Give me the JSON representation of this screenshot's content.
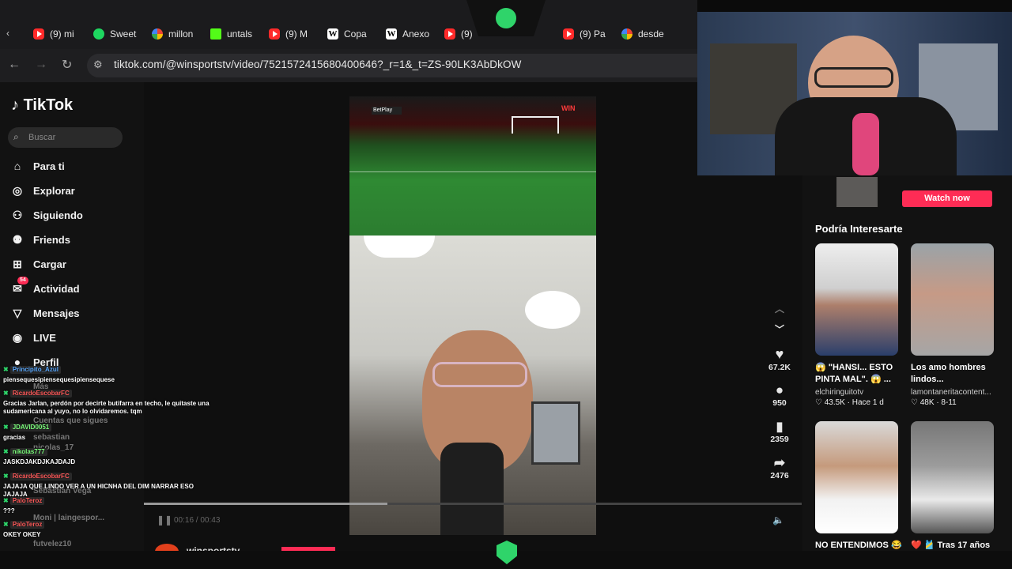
{
  "browser": {
    "tabs": [
      {
        "icon": "youtube-icon",
        "label": "(9) mi"
      },
      {
        "icon": "spotify-icon",
        "label": "Sweet"
      },
      {
        "icon": "google-icon",
        "label": "millon"
      },
      {
        "icon": "kick-icon",
        "label": "untals"
      },
      {
        "icon": "youtube-icon",
        "label": "(9) M"
      },
      {
        "icon": "wikipedia-icon",
        "label": "Copa"
      },
      {
        "icon": "wikipedia-icon",
        "label": "Anexo"
      },
      {
        "icon": "youtube-icon",
        "label": "(9)"
      },
      {
        "icon": "youtube-icon",
        "label": "(9) Pa"
      },
      {
        "icon": "google-icon",
        "label": "desde"
      }
    ],
    "url": "tiktok.com/@winsportstv/video/7521572415680400646?_r=1&_t=ZS-90LK3AbDkOW"
  },
  "tiktok": {
    "logo": "TikTok",
    "search_placeholder": "Buscar",
    "nav": [
      {
        "icon": "home-icon",
        "label": "Para ti"
      },
      {
        "icon": "compass-icon",
        "label": "Explorar"
      },
      {
        "icon": "following-icon",
        "label": "Siguiendo"
      },
      {
        "icon": "friends-icon",
        "label": "Friends"
      },
      {
        "icon": "upload-icon",
        "label": "Cargar"
      },
      {
        "icon": "activity-icon",
        "label": "Actividad",
        "badge": "54"
      },
      {
        "icon": "messages-icon",
        "label": "Mensajes"
      },
      {
        "icon": "live-icon",
        "label": "LIVE"
      },
      {
        "icon": "profile-icon",
        "label": "Perfil"
      }
    ],
    "sidebar_extra": [
      "Más",
      "Cuentas que sigues",
      "sebastian",
      "nicolas_17",
      "Sebastian Vega",
      "Moni | laingespor...",
      "futvelez10"
    ],
    "video": {
      "scoreboard": "BetPlay",
      "time": "00:16 / 00:43",
      "author": "winsportstv"
    },
    "actions": {
      "likes": "67.2K",
      "comments": "950",
      "saves": "2359",
      "shares": "2476"
    },
    "right_panel": {
      "watch_now": "Watch now",
      "heading": "Podría Interesarte",
      "cards": [
        {
          "title": "😱 \"HANSI... ESTO PINTA MAL\". 😱 ...",
          "author": "elchiringuitotv",
          "stats": "♡ 43.5K · Hace 1 d"
        },
        {
          "title": "Los amo hombres lindos...",
          "author": "lamontaneritacontent...",
          "stats": "♡ 48K · 8-11"
        },
        {
          "title": "NO ENTENDIMOS 😂",
          "author": "",
          "stats": ""
        },
        {
          "title": "❤️ 🎽 Tras 17 años",
          "author": "",
          "stats": ""
        }
      ]
    }
  },
  "chat": [
    {
      "user": "Principito_Azul",
      "msg": "piensequesipiensequesipiensequese",
      "color": "#5aa9ff"
    },
    {
      "user": "RicardoEscobarFC",
      "msg": "Gracias Jarlan, perdón por decirte butifarra en techo, le quitaste una sudamericana al yuyo, no lo olvidaremos. tqm",
      "color": "#ff5a5a"
    },
    {
      "user": "JDAVID0051",
      "msg": "gracias",
      "color": "#7dff7d"
    },
    {
      "user": "nikolas777",
      "msg": "JASKDJAKDJKAJDAJD",
      "color": "#7dff7d"
    },
    {
      "user": "RicardoEscobarFC",
      "msg": "JAJAJA QUE LINDO VER A UN HICNHA DEL DIM NARRAR ESO JAJAJA",
      "color": "#ff5a5a"
    },
    {
      "user": "PaloTeroz",
      "msg": "???",
      "color": "#ff5a5a"
    },
    {
      "user": "PaloTeroz",
      "msg": "OKEY OKEY",
      "color": "#ff5a5a"
    }
  ]
}
